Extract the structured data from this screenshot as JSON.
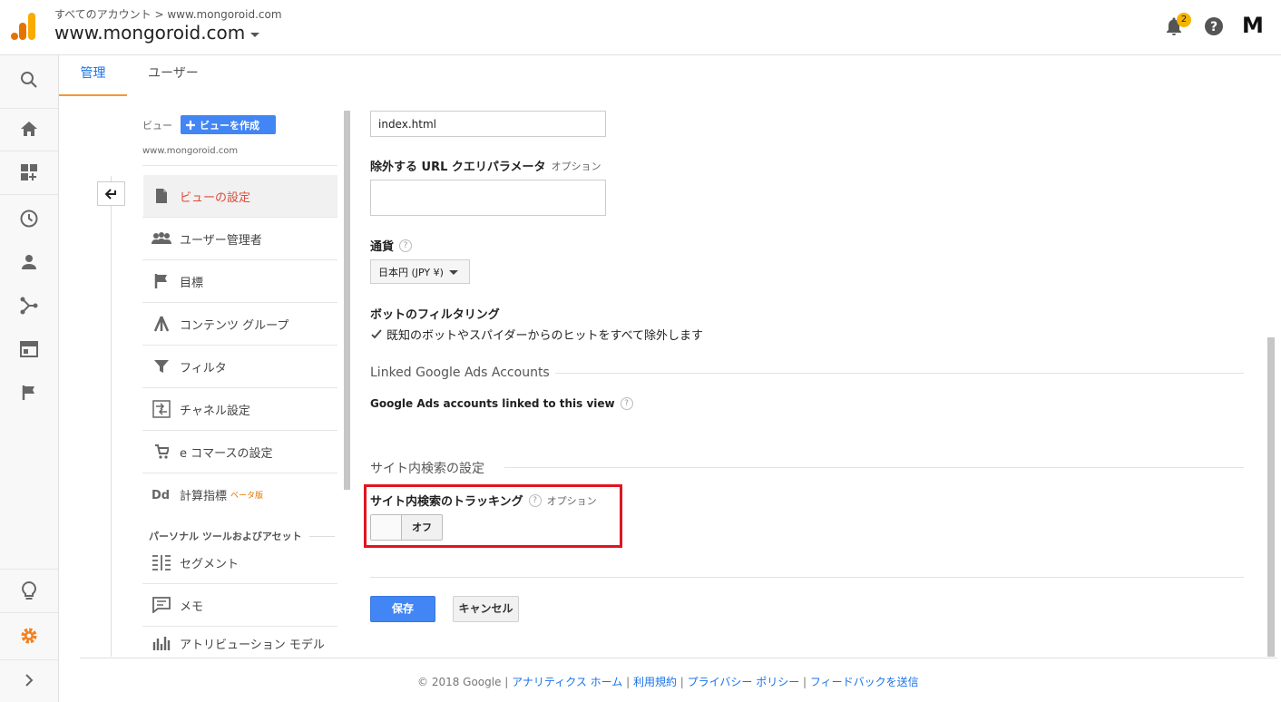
{
  "header": {
    "breadcrumb": "すべてのアカウント > www.mongoroid.com",
    "property": "www.mongoroid.com",
    "notification_count": "2",
    "account_initial": "M"
  },
  "tabs": [
    {
      "label": "管理"
    },
    {
      "label": "ユーザー"
    }
  ],
  "nav": {
    "view_label": "ビュー",
    "create_view": "ビューを作成",
    "view_name": "www.mongoroid.com",
    "items": [
      {
        "label": "ビューの設定",
        "icon": "document-icon"
      },
      {
        "label": "ユーザー管理者",
        "icon": "people-icon"
      },
      {
        "label": "目標",
        "icon": "flag-icon"
      },
      {
        "label": "コンテンツ グループ",
        "icon": "content-group-icon"
      },
      {
        "label": "フィルタ",
        "icon": "filter-icon"
      },
      {
        "label": "チャネル設定",
        "icon": "channel-icon"
      },
      {
        "label": "e コマースの設定",
        "icon": "cart-icon"
      },
      {
        "label": "計算指標",
        "icon": "dd-icon",
        "badge": "ベータ版"
      }
    ],
    "personal_section": "パーソナル ツールおよびアセット",
    "personal_items": [
      {
        "label": "セグメント",
        "icon": "segment-icon"
      },
      {
        "label": "メモ",
        "icon": "memo-icon"
      },
      {
        "label": "アトリビューション モデル",
        "icon": "attribution-icon"
      }
    ]
  },
  "form": {
    "default_page_value": "index.html",
    "exclude_params_label": "除外する URL クエリパラメータ",
    "exclude_params_optional": "オプション",
    "exclude_params_value": "",
    "currency_label": "通貨",
    "currency_value": "日本円 (JPY ¥)",
    "bot_filter_label": "ボットのフィルタリング",
    "bot_filter_checkbox": "既知のボットやスパイダーからのヒットをすべて除外します",
    "linked_ads_section": "Linked Google Ads Accounts",
    "linked_ads_label": "Google Ads accounts linked to this view",
    "site_search_section": "サイト内検索の設定",
    "site_search_tracking_label": "サイト内検索のトラッキング",
    "site_search_optional": "オプション",
    "toggle_state": "オフ",
    "save": "保存",
    "cancel": "キャンセル"
  },
  "footer": {
    "copyright": "© 2018 Google",
    "links": [
      "アナリティクス ホーム",
      "利用規約",
      "プライバシー ポリシー",
      "フィードバックを送信"
    ]
  },
  "colors": {
    "accent_blue": "#4285f4",
    "active_red": "#dd4b39",
    "tab_underline": "#f29a31",
    "highlight_box": "#e0151f",
    "settings_gear": "#f4811f"
  }
}
